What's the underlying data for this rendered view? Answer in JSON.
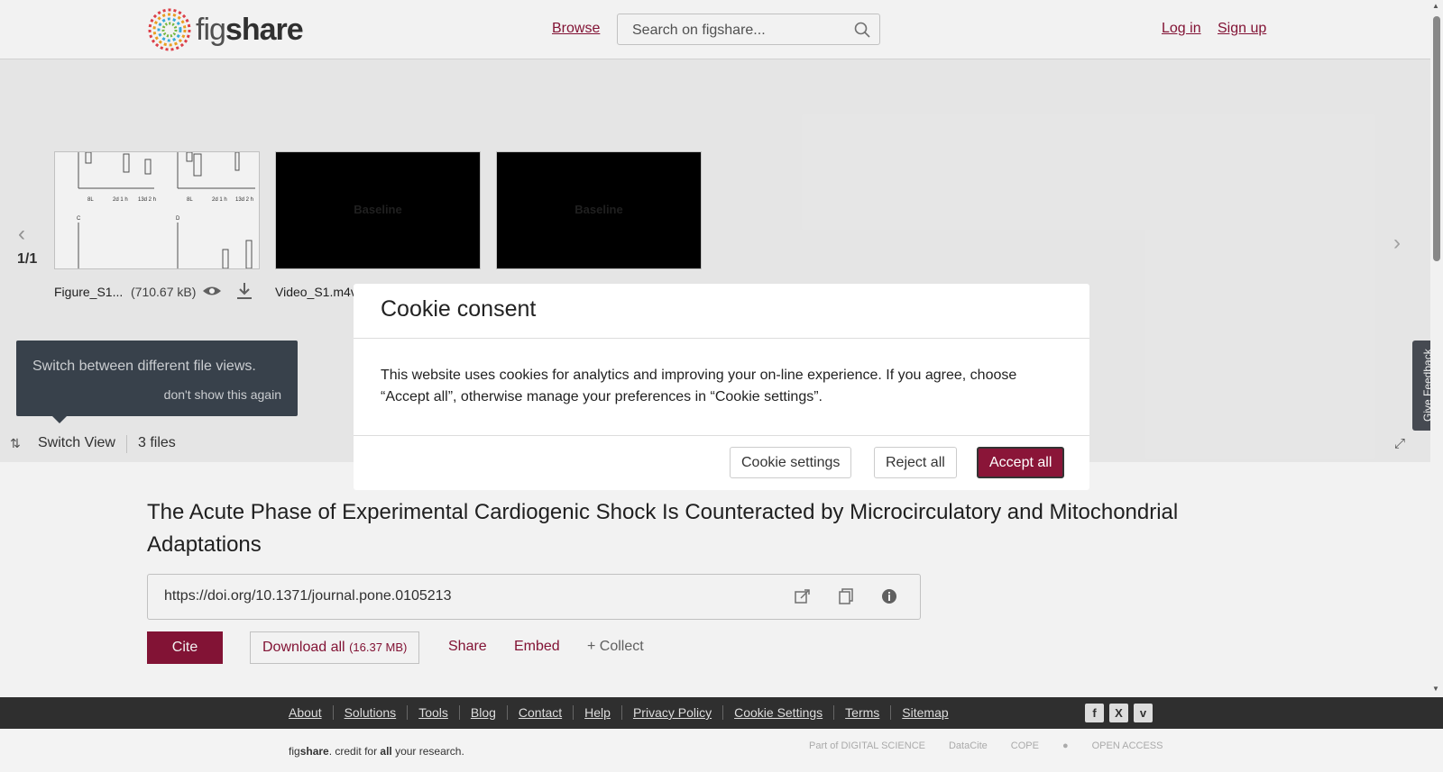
{
  "header": {
    "logo_text_a": "fig",
    "logo_text_b": "share",
    "browse": "Browse",
    "search_placeholder": "Search on figshare...",
    "login": "Log in",
    "signup": "Sign up"
  },
  "viewer": {
    "counter": "1/1",
    "files": [
      {
        "name": "Figure_S1...",
        "size": "(710.67 kB)"
      },
      {
        "name": "Video_S1.m4v",
        "thumb_text": "Baseline"
      },
      {
        "name": "",
        "thumb_text": "Baseline"
      }
    ],
    "tooltip_text": "Switch between different file views.",
    "tooltip_dismiss": "don't show this again",
    "switch_view": "Switch View",
    "file_count": "3 files"
  },
  "feedback": "Give Feedback",
  "item": {
    "title": "The Acute Phase of Experimental Cardiogenic Shock Is Counteracted by Microcirculatory and Mitochondrial Adaptations",
    "doi": "https://doi.org/10.1371/journal.pone.0105213",
    "cite": "Cite",
    "download_all": "Download all",
    "download_size": "(16.37 MB)",
    "share": "Share",
    "embed": "Embed",
    "collect": "+ Collect"
  },
  "cookie": {
    "title": "Cookie consent",
    "body": "This website uses cookies for analytics and improving your on-line experience. If you agree, choose “Accept all”, otherwise manage your preferences in “Cookie settings”.",
    "settings": "Cookie settings",
    "reject": "Reject all",
    "accept": "Accept all"
  },
  "footer": {
    "links": [
      "About",
      "Solutions",
      "Tools",
      "Blog",
      "Contact",
      "Help",
      "Privacy Policy",
      "Cookie Settings",
      "Terms",
      "Sitemap"
    ],
    "social": [
      "f",
      "X",
      "v"
    ],
    "tagline_a": "fig",
    "tagline_b": "share",
    "tagline_c": ". credit for ",
    "tagline_d": "all",
    "tagline_e": " your research.",
    "partners": [
      "Part of DIGITAL SCIENCE",
      "DataCite",
      "COPE",
      "",
      "OPEN ACCESS"
    ]
  },
  "colors": {
    "accent": "#8a1538"
  }
}
